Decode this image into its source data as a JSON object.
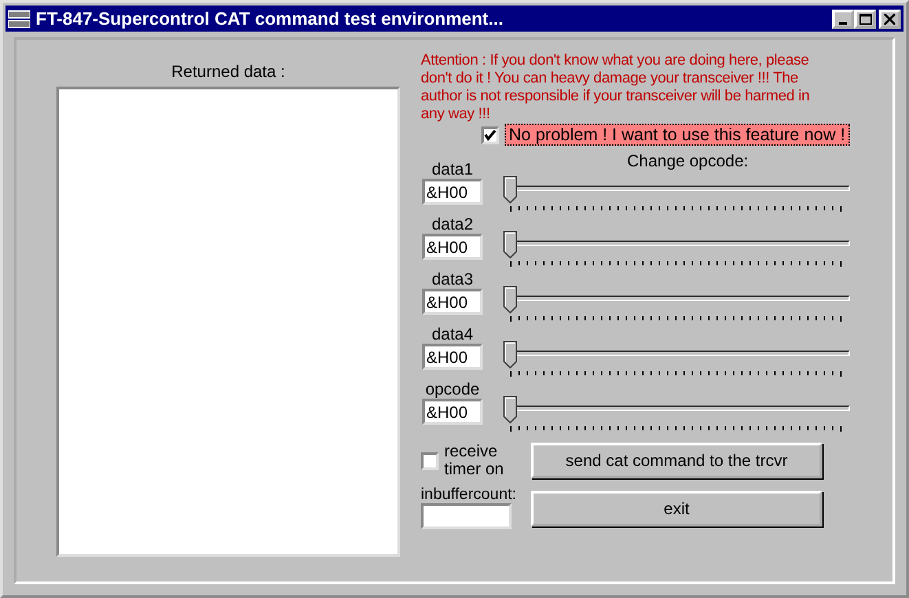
{
  "window": {
    "title": "FT-847-Supercontrol CAT command test environment..."
  },
  "returned_data": {
    "label": "Returned data :"
  },
  "warning": "Attention : If you don't know what you are doing here, please don't do it ! You can heavy damage your transceiver !!! The author is not responsible if your transceiver will be harmed in any way !!!",
  "confirm": {
    "label": "No problem ! I want to use this feature now !",
    "checked": true
  },
  "slider_heading": "Change opcode:",
  "fields": [
    {
      "label": "data1",
      "value": "&H00",
      "level": 0
    },
    {
      "label": "data2",
      "value": "&H00",
      "level": 0
    },
    {
      "label": "data3",
      "value": "&H00",
      "level": 0
    },
    {
      "label": "data4",
      "value": "&H00",
      "level": 0
    },
    {
      "label": "opcode",
      "value": "&H00",
      "level": 0
    }
  ],
  "receive_timer": {
    "label": "receive timer on",
    "checked": false
  },
  "inbuffercount": {
    "label": "inbuffercount:"
  },
  "buttons": [
    "send cat command to the trcvr",
    "exit"
  ]
}
